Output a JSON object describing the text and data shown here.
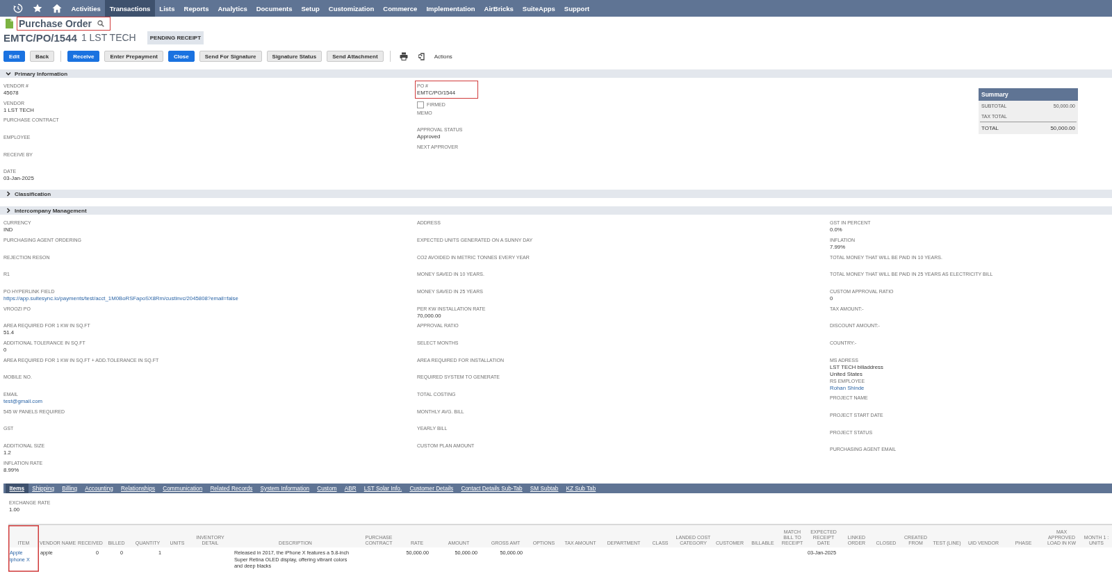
{
  "nav": {
    "items": [
      {
        "label": "Activities",
        "selected": false
      },
      {
        "label": "Transactions",
        "selected": true
      },
      {
        "label": "Lists",
        "selected": false
      },
      {
        "label": "Reports",
        "selected": false
      },
      {
        "label": "Analytics",
        "selected": false
      },
      {
        "label": "Documents",
        "selected": false
      },
      {
        "label": "Setup",
        "selected": false
      },
      {
        "label": "Customization",
        "selected": false
      },
      {
        "label": "Commerce",
        "selected": false
      },
      {
        "label": "Implementation",
        "selected": false
      },
      {
        "label": "AirBricks",
        "selected": false
      },
      {
        "label": "SuiteApps",
        "selected": false
      },
      {
        "label": "Support",
        "selected": false
      }
    ]
  },
  "page_title": {
    "text": "Purchase Order",
    "highlighted": true
  },
  "record": {
    "number": "EMTC/PO/1544",
    "name": "1 LST TECH",
    "status": "PENDING RECEIPT"
  },
  "toolbar": {
    "groups": [
      [
        {
          "label": "Edit",
          "kind": "primary"
        },
        {
          "label": "Back",
          "kind": "secondary"
        }
      ],
      [
        {
          "label": "Receive",
          "kind": "primary"
        },
        {
          "label": "Enter Prepayment",
          "kind": "secondary"
        },
        {
          "label": "Close",
          "kind": "primary"
        },
        {
          "label": "Send For Signature",
          "kind": "secondary"
        },
        {
          "label": "Signature Status",
          "kind": "secondary"
        },
        {
          "label": "Send Attachment",
          "kind": "secondary"
        }
      ]
    ],
    "actions_label": "Actions"
  },
  "primary_section": {
    "title": "Primary Information",
    "expanded": true,
    "columns": [
      [
        {
          "label": "VENDOR #",
          "value": "45678",
          "kind": "text"
        },
        {
          "label": "VENDOR",
          "value": "1 LST TECH",
          "kind": "text"
        },
        {
          "label": "PURCHASE CONTRACT",
          "kind": "text"
        },
        {
          "label": "EMPLOYEE",
          "kind": "text"
        },
        {
          "label": "RECEIVE BY",
          "kind": "text"
        },
        {
          "label": "DATE",
          "value": "03-Jan-2025",
          "kind": "text"
        }
      ],
      [
        {
          "label": "PO #",
          "value": "EMTC/PO/1544",
          "kind": "text",
          "highlighted": true
        },
        {
          "label": "FIRMED",
          "kind": "checkbox",
          "checked": false
        },
        {
          "label": "MEMO",
          "kind": "text"
        },
        {
          "label": "APPROVAL STATUS",
          "value": "Approved",
          "kind": "text"
        },
        {
          "label": "NEXT APPROVER",
          "kind": "text"
        }
      ]
    ]
  },
  "summary": {
    "title": "Summary",
    "rows": [
      {
        "label": "SUBTOTAL",
        "value": "50,000.00",
        "kind": "line"
      },
      {
        "label": "TAX TOTAL",
        "kind": "line"
      },
      {
        "label": "TOTAL",
        "value": "50,000.00",
        "kind": "total"
      }
    ]
  },
  "collapsed_sections": [
    {
      "title": "Classification",
      "expanded": false
    },
    {
      "title": "Intercompany Management",
      "expanded": false
    }
  ],
  "custom_fields": {
    "columns": [
      [
        {
          "label": "CURRENCY",
          "value": "IND",
          "kind": "text"
        },
        {
          "label": "PURCHASING AGENT ORDERING",
          "kind": "text"
        },
        {
          "label": "REJECTION RESON",
          "kind": "text"
        },
        {
          "label": "R1",
          "kind": "text"
        },
        {
          "label": "PO HYPERLINK FIELD",
          "value": "https://app.suitesync.io/payments/test/acct_1M0BoRSFapoSX8Rm/custinvc/2045808?email=false",
          "kind": "link"
        },
        {
          "label": "VROOZI PO",
          "kind": "text"
        },
        {
          "label": "AREA REQUIRED FOR 1 KW IN SQ.FT",
          "value": "51.4",
          "kind": "text"
        },
        {
          "label": "ADDITIONAL TOLERANCE IN SQ.FT",
          "value": "0",
          "kind": "text"
        },
        {
          "label": "AREA REQUIRED FOR 1 KW IN SQ.FT + ADD.TOLERANCE IN SQ.FT",
          "kind": "text"
        },
        {
          "label": "MOBILE NO.",
          "kind": "text"
        },
        {
          "label": "EMAIL",
          "value": "test@gmail.com",
          "kind": "link"
        },
        {
          "label": "545 W PANELS REQUIRED",
          "kind": "text"
        },
        {
          "label": "GST",
          "kind": "text"
        },
        {
          "label": "ADDITIONAL SIZE",
          "value": "1.2",
          "kind": "text"
        },
        {
          "label": "INFLATION RATE",
          "value": "8.99%",
          "kind": "text"
        }
      ],
      [
        {
          "label": "ADDRESS",
          "kind": "text"
        },
        {
          "label": "EXPECTED UNITS GENERATED ON A SUNNY DAY",
          "kind": "text"
        },
        {
          "label": "CO2 AVOIDED IN METRIC TONNES EVERY YEAR",
          "kind": "text"
        },
        {
          "label": "MONEY SAVED IN 10 YEARS.",
          "kind": "text"
        },
        {
          "label": "MONEY SAVED IN 25 YEARS",
          "kind": "text"
        },
        {
          "label": "PER KW INSTALLATION RATE",
          "value": "70,000.00",
          "kind": "text"
        },
        {
          "label": "APPROVAL RATIO",
          "kind": "text"
        },
        {
          "label": "SELECT MONTHS",
          "kind": "text"
        },
        {
          "label": "AREA REQUIRED FOR INSTALLATION",
          "kind": "text"
        },
        {
          "label": "REQUIRED SYSTEM TO GENERATE",
          "kind": "text"
        },
        {
          "label": "TOTAL COSTING",
          "kind": "text"
        },
        {
          "label": "MONTHLY AVG. BILL",
          "kind": "text"
        },
        {
          "label": "YEARLY BILL",
          "kind": "text"
        },
        {
          "label": "CUSTOM PLAN AMOUNT",
          "kind": "text"
        }
      ],
      [
        {
          "label": "GST IN PERCENT",
          "value": "0.0%",
          "kind": "text"
        },
        {
          "label": "INFLATION",
          "value": "7.99%",
          "kind": "text"
        },
        {
          "label": "TOTAL MONEY THAT WILL BE PAID IN 10 YEARS.",
          "kind": "text"
        },
        {
          "label": "TOTAL MONEY THAT WILL BE PAID IN 25 YEARS AS ELECTRICITY BILL",
          "kind": "text"
        },
        {
          "label": "CUSTOM APPROVAL RATIO",
          "value": "0",
          "kind": "text"
        },
        {
          "label": "TAX AMOUNT:-",
          "kind": "text"
        },
        {
          "label": "DISCOUNT AMOUNT:-",
          "kind": "text"
        },
        {
          "label": "COUNTRY:-",
          "kind": "text"
        },
        {
          "label": "MS ADRESS",
          "value": "LST TECH billaddress\nUnited States",
          "kind": "text"
        },
        {
          "label": "RS EMPLOYEE",
          "value": "Rohan Shinde",
          "kind": "link"
        },
        {
          "label": "PROJECT NAME",
          "kind": "text"
        },
        {
          "label": "PROJECT START DATE",
          "kind": "text"
        },
        {
          "label": "PROJECT STATUS",
          "kind": "text"
        },
        {
          "label": "PURCHASING AGENT EMAIL",
          "kind": "text"
        }
      ]
    ]
  },
  "subtabs": [
    {
      "label": "Items",
      "selected": true
    },
    {
      "label": "Shipping",
      "selected": false
    },
    {
      "label": "Billing",
      "selected": false
    },
    {
      "label": "Accounting",
      "selected": false
    },
    {
      "label": "Relationships",
      "selected": false
    },
    {
      "label": "Communication",
      "selected": false
    },
    {
      "label": "Related Records",
      "selected": false
    },
    {
      "label": "System Information",
      "selected": false
    },
    {
      "label": "Custom",
      "selected": false
    },
    {
      "label": "ABR",
      "selected": false
    },
    {
      "label": "LST Solar Info.",
      "selected": false
    },
    {
      "label": "Customer Details",
      "selected": false
    },
    {
      "label": "Contact Details Sub-Tab",
      "selected": false
    },
    {
      "label": "SM Subtab",
      "selected": false
    },
    {
      "label": "KZ Sub Tab",
      "selected": false
    }
  ],
  "exchange_rate": {
    "label": "EXCHANGE RATE",
    "value": "1.00"
  },
  "items_table": {
    "columns": [
      {
        "label": "ITEM",
        "kind": "link",
        "highlighted": true
      },
      {
        "label": "VENDOR NAME",
        "kind": "text",
        "highlighted": false
      },
      {
        "label": "RECEIVED",
        "kind": "number",
        "highlighted": false
      },
      {
        "label": "BILLED",
        "kind": "number",
        "highlighted": false
      },
      {
        "label": "QUANTITY",
        "kind": "number",
        "highlighted": false
      },
      {
        "label": "UNITS",
        "kind": "text",
        "highlighted": false
      },
      {
        "label": "INVENTORY DETAIL",
        "kind": "text",
        "highlighted": false
      },
      {
        "label": "DESCRIPTION",
        "kind": "text",
        "highlighted": false
      },
      {
        "label": "PURCHASE CONTRACT",
        "kind": "text",
        "highlighted": false
      },
      {
        "label": "RATE",
        "kind": "number",
        "highlighted": false
      },
      {
        "label": "AMOUNT",
        "kind": "number",
        "highlighted": false
      },
      {
        "label": "GROSS AMT",
        "kind": "number",
        "highlighted": false
      },
      {
        "label": "OPTIONS",
        "kind": "text",
        "highlighted": false
      },
      {
        "label": "TAX AMOUNT",
        "kind": "number",
        "highlighted": false
      },
      {
        "label": "DEPARTMENT",
        "kind": "text",
        "highlighted": false
      },
      {
        "label": "CLASS",
        "kind": "text",
        "highlighted": false
      },
      {
        "label": "LANDED COST CATEGORY",
        "kind": "text",
        "highlighted": false
      },
      {
        "label": "CUSTOMER",
        "kind": "text",
        "highlighted": false
      },
      {
        "label": "BILLABLE",
        "kind": "text",
        "highlighted": false
      },
      {
        "label": "MATCH BILL TO RECEIPT",
        "kind": "text",
        "highlighted": false
      },
      {
        "label": "EXPECTED RECEIPT DATE",
        "kind": "text",
        "highlighted": false
      },
      {
        "label": "LINKED ORDER",
        "kind": "text",
        "highlighted": false
      },
      {
        "label": "CLOSED",
        "kind": "text",
        "highlighted": false
      },
      {
        "label": "CREATED FROM",
        "kind": "text",
        "highlighted": false
      },
      {
        "label": "TEST (LINE)",
        "kind": "text",
        "highlighted": false
      },
      {
        "label": "UID VENDOR",
        "kind": "text",
        "highlighted": false
      },
      {
        "label": "PHASE",
        "kind": "text",
        "highlighted": false
      },
      {
        "label": "MAX APPROVED LOAD IN KW",
        "kind": "text",
        "highlighted": false
      },
      {
        "label": "MONTH 1 : UNITS",
        "kind": "text",
        "highlighted": false
      }
    ],
    "rows": [
      {
        "cells": [
          "Apple iphone X",
          "apple",
          "0",
          "0",
          "1",
          null,
          null,
          "Released in 2017, the iPhone X features a 5.8-inch Super Retina OLED display, offering vibrant colors and deep blacks",
          null,
          "50,000.00",
          "50,000.00",
          "50,000.00",
          null,
          null,
          null,
          null,
          null,
          null,
          null,
          null,
          "03-Jan-2025",
          null,
          null,
          null,
          null,
          null,
          null,
          null,
          null
        ]
      }
    ]
  }
}
